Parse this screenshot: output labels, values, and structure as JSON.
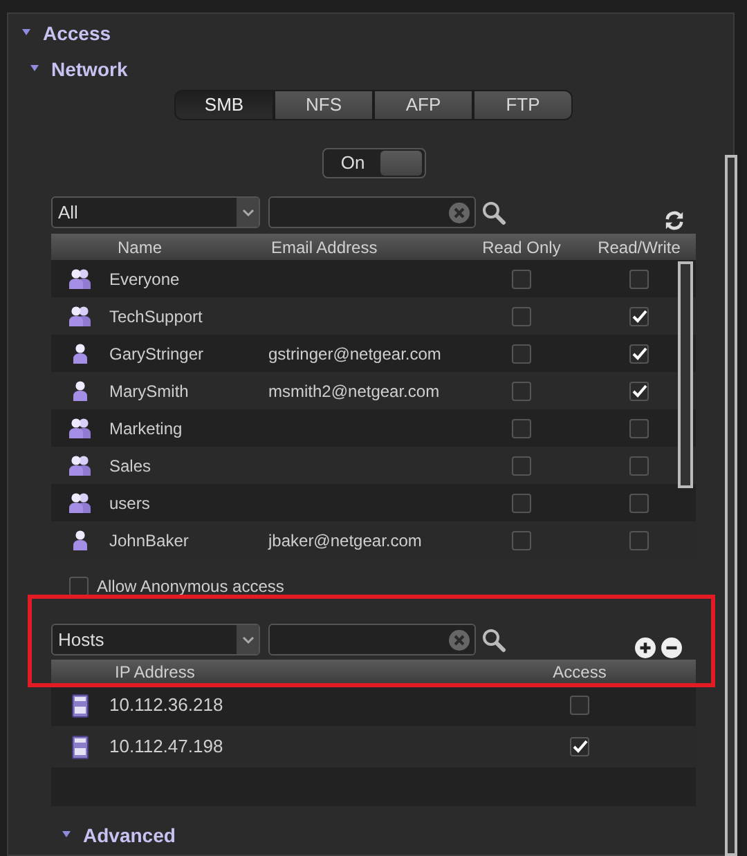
{
  "sections": [
    {
      "title": "Access",
      "expanded": true
    },
    {
      "title": "Network",
      "expanded": true
    }
  ],
  "tabs": [
    {
      "label": "SMB",
      "selected": true
    },
    {
      "label": "NFS",
      "selected": false
    },
    {
      "label": "AFP",
      "selected": false
    },
    {
      "label": "FTP",
      "selected": false
    }
  ],
  "toggle": {
    "label": "On",
    "on": true
  },
  "users": {
    "filter": "All",
    "columns": [
      "Name",
      "Email Address",
      "Read Only",
      "Read/Write"
    ],
    "rows": [
      {
        "kind": "group",
        "name": "Everyone",
        "read_only": false,
        "read_write": false
      },
      {
        "kind": "group",
        "name": "TechSupport",
        "read_only": false,
        "read_write": true
      },
      {
        "kind": "user",
        "name": "GaryStringer",
        "email": "gstringer@netgear.com",
        "read_only": false,
        "read_write": true
      },
      {
        "kind": "user",
        "name": "MarySmith",
        "email": "msmith2@netgear.com",
        "read_only": false,
        "read_write": true
      },
      {
        "kind": "group",
        "name": "Marketing",
        "read_only": false,
        "read_write": false
      },
      {
        "kind": "group",
        "name": "Sales",
        "read_only": false,
        "read_write": false
      },
      {
        "kind": "group",
        "name": "users",
        "read_only": false,
        "read_write": false
      },
      {
        "kind": "user",
        "name": "JohnBaker",
        "email": "jbaker@netgear.com",
        "read_only": false,
        "read_write": false
      }
    ]
  },
  "anonymous": {
    "label": "Allow Anonymous access",
    "checked": false
  },
  "hosts": {
    "filter": "Hosts",
    "columns": [
      "IP Address",
      "Access"
    ],
    "rows": [
      {
        "ip": "10.112.36.218",
        "access": false
      },
      {
        "ip": "10.112.47.198",
        "access": true
      }
    ]
  },
  "advanced": {
    "title": "Advanced",
    "expanded": true
  }
}
